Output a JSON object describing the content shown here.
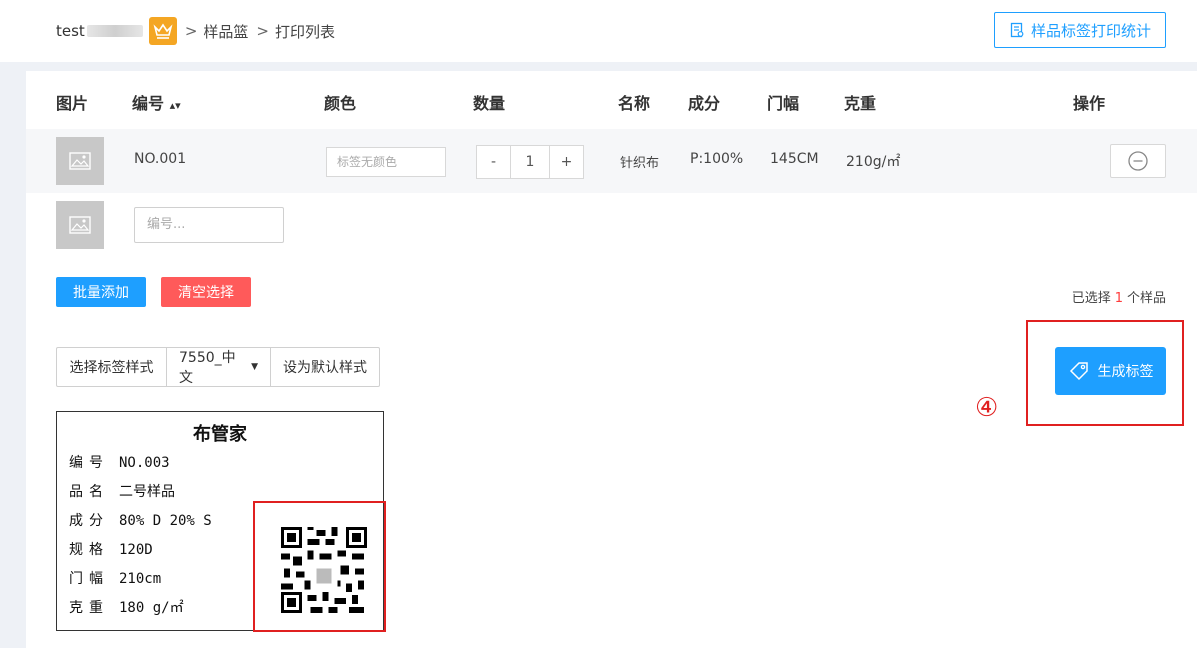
{
  "header": {
    "user": "test",
    "breadcrumb": [
      ">",
      "样品篮",
      ">",
      "打印列表"
    ],
    "stats_button": "样品标签打印统计"
  },
  "table": {
    "columns": {
      "image": "图片",
      "code": "编号",
      "color": "颜色",
      "quantity": "数量",
      "name": "名称",
      "composition": "成分",
      "width": "门幅",
      "weight": "克重",
      "actions": "操作"
    },
    "rows": [
      {
        "code": "NO.001",
        "color_placeholder": "标签无颜色",
        "quantity": "1",
        "minus": "-",
        "plus": "+",
        "name": "针织布",
        "composition": "P:100%",
        "width": "145CM",
        "weight": "210g/㎡"
      }
    ],
    "new_row": {
      "code_placeholder": "编号..."
    }
  },
  "actions": {
    "batch_add": "批量添加",
    "clear_selection": "清空选择",
    "selected_prefix": "已选择",
    "selected_count": "1",
    "selected_suffix": "个样品"
  },
  "label_style": {
    "select_label": "选择标签样式",
    "current_style": "7550_中文",
    "set_default": "设为默认样式"
  },
  "generate_button": "生成标签",
  "step_marker": "④",
  "label_preview": {
    "title": "布管家",
    "lines": [
      {
        "key": "编号",
        "value": "NO.003"
      },
      {
        "key": "品名",
        "value": "二号样品"
      },
      {
        "key": "成分",
        "value": "80% D 20% S"
      },
      {
        "key": "规格",
        "value": "120D"
      },
      {
        "key": "门幅",
        "value": "210cm"
      },
      {
        "key": "克重",
        "value": "180 g/㎡"
      }
    ]
  },
  "colors": {
    "primary": "#1e9fff",
    "danger": "#ff5a5a",
    "highlight": "#e02020",
    "crown": "#f4a623"
  }
}
